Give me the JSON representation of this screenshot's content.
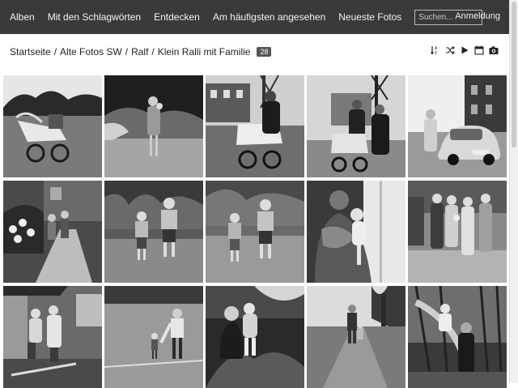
{
  "nav": {
    "items": [
      "Alben",
      "Mit den Schlagwörten",
      "Entdecken",
      "Am häufigsten angesehen",
      "Neueste Fotos"
    ],
    "search_placeholder": "Suchen...",
    "login": "Anmeldung"
  },
  "breadcrumb": {
    "items": [
      "Startseite",
      "Alte Fotos SW",
      "Ralf",
      "Klein Ralli mit Familie"
    ],
    "separator": "/",
    "count": "28"
  },
  "toolbar": {
    "icons": [
      "sort-icon",
      "slideshow-random-icon",
      "play-icon",
      "calendar-icon",
      "camera-icon"
    ]
  },
  "photos": [
    {
      "id": "photo-1",
      "scene": "baby carriage on lawn"
    },
    {
      "id": "photo-2",
      "scene": "woman holding child in garden"
    },
    {
      "id": "photo-3",
      "scene": "pram in front of houses"
    },
    {
      "id": "photo-4",
      "scene": "two women with pram"
    },
    {
      "id": "photo-5",
      "scene": "woman beside car"
    },
    {
      "id": "photo-6",
      "scene": "children on garden path"
    },
    {
      "id": "photo-7",
      "scene": "two boys in garden"
    },
    {
      "id": "photo-8",
      "scene": "two boys on lawn"
    },
    {
      "id": "photo-9",
      "scene": "woman holding baby"
    },
    {
      "id": "photo-10",
      "scene": "family group portrait"
    },
    {
      "id": "photo-11",
      "scene": "family on terrace"
    },
    {
      "id": "photo-12",
      "scene": "man with child in yard"
    },
    {
      "id": "photo-13",
      "scene": "man crouching with child"
    },
    {
      "id": "photo-14",
      "scene": "man and child on forest path"
    },
    {
      "id": "photo-15",
      "scene": "man holding child on tree"
    }
  ]
}
